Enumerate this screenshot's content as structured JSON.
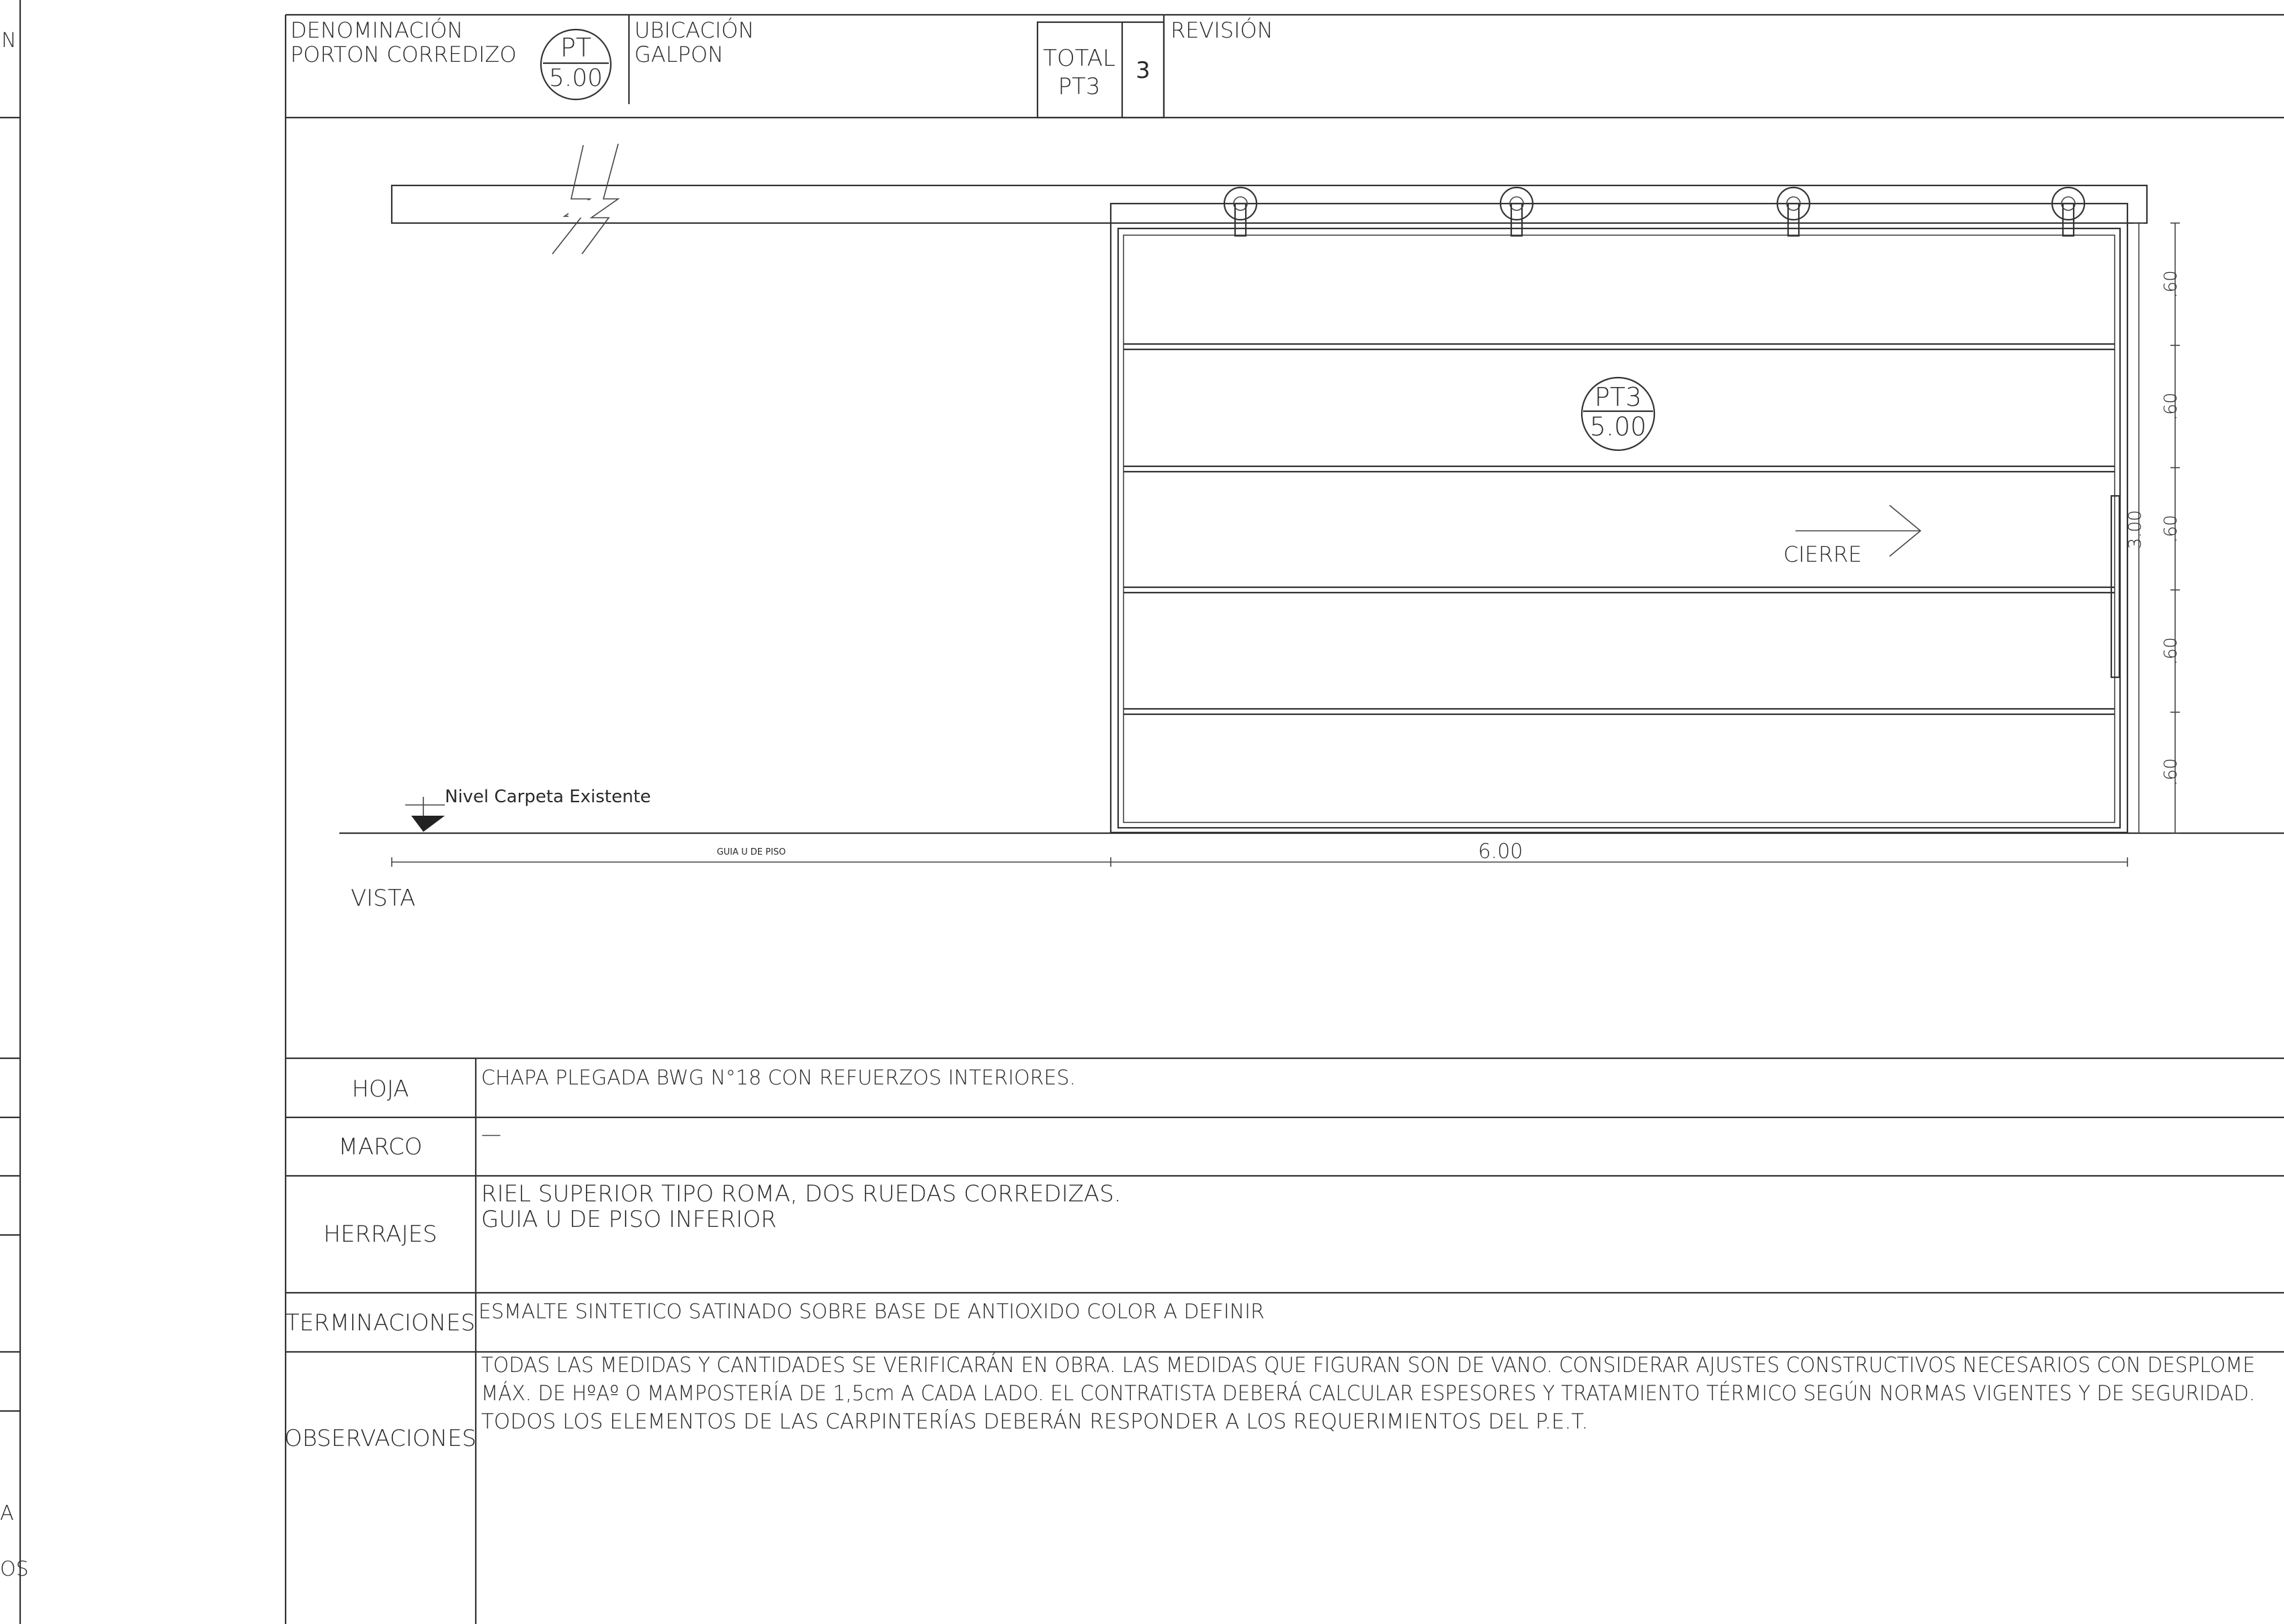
{
  "header": {
    "denominacion_label": "DENOMINACIÓN",
    "denominacion_value": "PORTON CORREDIZO",
    "ref_top": "PT",
    "ref_bottom": "5.00",
    "ubicacion_label": "UBICACIÓN",
    "ubicacion_value": "GALPON",
    "total_label": "TOTAL",
    "total_code": "PT3",
    "total_count": "3",
    "revision_label": "REVISIÓN"
  },
  "drawing": {
    "tag_top": "PT3",
    "tag_bottom": "5.00",
    "cierre_label": "CIERRE",
    "nivel_label": "Nivel  Carpeta  Existente",
    "guia_label": "GUIA U DE PISO",
    "width_dim": "6.00",
    "height_dim": "3.00",
    "panel_dims": [
      ".60",
      ".60",
      ".60",
      ".60",
      ".60"
    ],
    "view_label": "VISTA"
  },
  "specs": [
    {
      "label": "HOJA",
      "lines": [
        "CHAPA PLEGADA BWG N°18 CON REFUERZOS INTERIORES."
      ]
    },
    {
      "label": "MARCO",
      "lines": [
        "—"
      ]
    },
    {
      "label": "HERRAJES",
      "lines": [
        "RIEL SUPERIOR TIPO ROMA, DOS RUEDAS CORREDIZAS.",
        "GUIA U DE PISO INFERIOR"
      ]
    },
    {
      "label": "TERMINACIONES",
      "lines": [
        "ESMALTE SINTETICO SATINADO SOBRE BASE DE ANTIOXIDO COLOR A DEFINIR"
      ]
    },
    {
      "label": "OBSERVACIONES",
      "lines": [
        "TODAS LAS MEDIDAS Y CANTIDADES SE VERIFICARÁN EN OBRA. LAS MEDIDAS QUE FIGURAN SON DE VANO. CONSIDERAR AJUSTES CONSTRUCTIVOS NECESARIOS CON DESPLOME",
        "MÁX. DE HºAº O MAMPOSTERÍA DE 1,5cm A CADA LADO. EL CONTRATISTA DEBERÁ CALCULAR ESPESORES Y TRATAMIENTO TÉRMICO SEGÚN NORMAS VIGENTES Y DE SEGURIDAD.",
        "TODOS LOS ELEMENTOS DE LAS CARPINTERÍAS DEBERÁN RESPONDER A LOS REQUERIMIENTOS DEL P.E.T."
      ]
    }
  ],
  "left_fragments": [
    "N",
    "A",
    "OS"
  ]
}
